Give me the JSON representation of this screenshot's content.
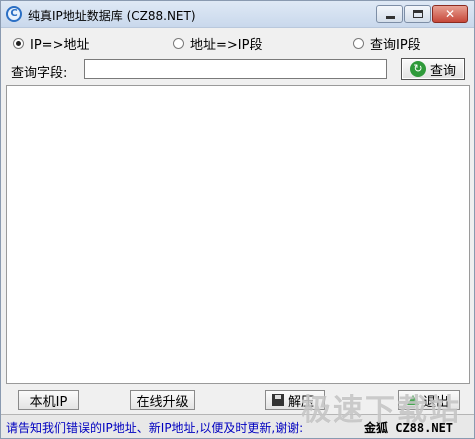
{
  "window": {
    "title": "纯真IP地址数据库 (CZ88.NET)",
    "controls": {
      "close_glyph": "✕"
    }
  },
  "search_mode": {
    "options": [
      {
        "label": "IP=>地址",
        "checked": true
      },
      {
        "label": "地址=>IP段",
        "checked": false
      },
      {
        "label": "查询IP段",
        "checked": false
      }
    ]
  },
  "query": {
    "label": "查询字段:",
    "value": "",
    "button_label": "查询",
    "button_icon": "refresh-icon"
  },
  "results": {
    "content": ""
  },
  "footer": {
    "local_ip_label": "本机IP",
    "upgrade_label": "在线升级",
    "extract_label": "解压",
    "exit_label": "退出"
  },
  "status_bar": {
    "message": "请告知我们错误的IP地址、新IP地址,以便及时更新,谢谢:",
    "brand": "金狐 CZ88.NET"
  },
  "watermark": {
    "text": "极速下载站"
  },
  "colors": {
    "status_text": "#0000c0",
    "title_gradient_top": "#dfe9f5",
    "close_button": "#c6483a"
  }
}
